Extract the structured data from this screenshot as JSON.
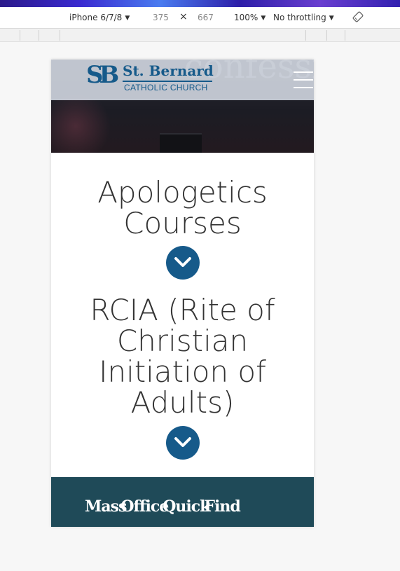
{
  "devtools": {
    "device": "iPhone 6/7/8",
    "width": "375",
    "times": "×",
    "height": "667",
    "zoom": "100%",
    "throttle": "No throttling",
    "caret": "▼"
  },
  "header": {
    "logo_mark": "SB",
    "logo_name": "St. Bernard",
    "logo_sub": "CATHOLIC CHURCH",
    "watermark": "confession"
  },
  "courses": [
    {
      "title": "Apologetics Courses"
    },
    {
      "title": "RCIA (Rite of Christian Initiation of Adults)"
    }
  ],
  "footer": {
    "links": [
      "Mass",
      "Office",
      "Quick",
      "Find"
    ]
  },
  "colors": {
    "brand_blue": "#165a8a",
    "footer_teal": "#1f4a58"
  }
}
